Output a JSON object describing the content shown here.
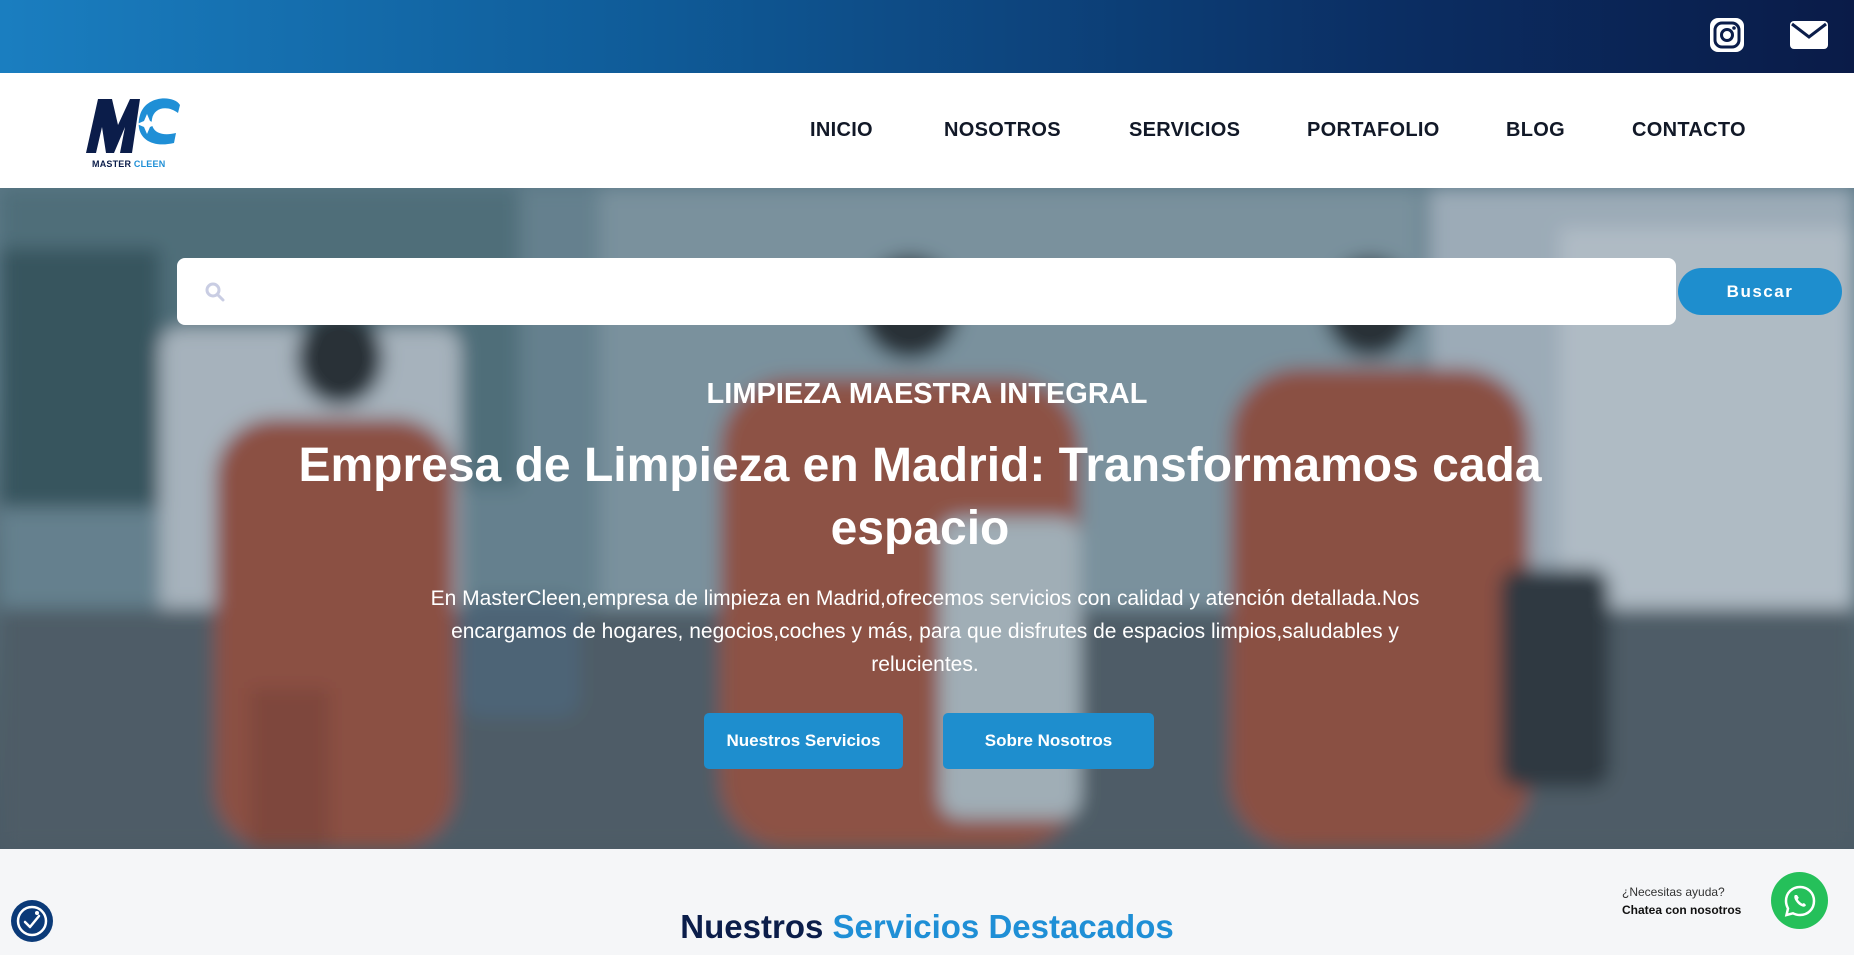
{
  "topbar": {
    "icons": [
      "instagram-icon",
      "mail-icon"
    ]
  },
  "brand": {
    "logo_letters": "MC",
    "name_part1": "MASTER",
    "name_part2": "CLEEN"
  },
  "nav": {
    "items": [
      {
        "label": "INICIO"
      },
      {
        "label": "NOSOTROS"
      },
      {
        "label": "SERVICIOS"
      },
      {
        "label": "PORTAFOLIO"
      },
      {
        "label": "BLOG"
      },
      {
        "label": "CONTACTO"
      }
    ]
  },
  "search": {
    "value": "",
    "placeholder": "",
    "button_label": "Buscar"
  },
  "hero": {
    "eyebrow": "LIMPIEZA MAESTRA INTEGRAL",
    "headline": "Empresa de Limpieza en Madrid: Transformamos cada espacio",
    "lede": "En MasterCleen,empresa de limpieza en Madrid,ofrecemos servicios con calidad y atención detallada.Nos encargamos de hogares, negocios,coches y más, para que disfrutes de espacios limpios,saludables y relucientes.",
    "btn_services": "Nuestros Servicios",
    "btn_about": "Sobre Nosotros"
  },
  "section": {
    "title_part1": "Nuestros",
    "title_part2": "Servicios Destacados"
  },
  "chat": {
    "help": "¿Necesitas ayuda?",
    "cta": "Chatea con nosotros"
  },
  "colors": {
    "accent": "#1e8ece",
    "navy": "#0b1d4a",
    "whatsapp": "#25c05a"
  }
}
